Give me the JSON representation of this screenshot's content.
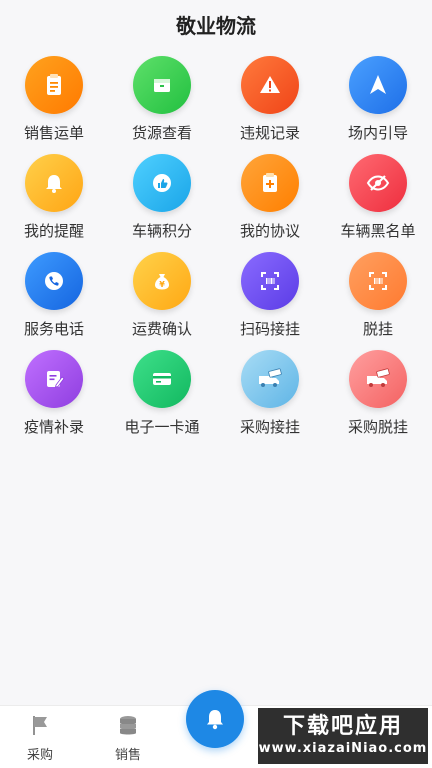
{
  "header": {
    "title": "敬业物流"
  },
  "menu": [
    {
      "label": "销售运单",
      "icon": "clipboard-icon",
      "color": "#ff8a00"
    },
    {
      "label": "货源查看",
      "icon": "box-icon",
      "color": "#3fcf4f"
    },
    {
      "label": "违规记录",
      "icon": "warning-icon",
      "color": "#ff5a22"
    },
    {
      "label": "场内引导",
      "icon": "navigation-arrow-icon",
      "color": "#2f86f6"
    },
    {
      "label": "我的提醒",
      "icon": "bell-icon",
      "color": "#ffb21e"
    },
    {
      "label": "车辆积分",
      "icon": "thumbs-up-icon",
      "color": "#22b7f0"
    },
    {
      "label": "我的协议",
      "icon": "document-plus-icon",
      "color": "#ff8c14"
    },
    {
      "label": "车辆黑名单",
      "icon": "eye-slash-icon",
      "color": "#f5414f"
    },
    {
      "label": "服务电话",
      "icon": "phone-icon",
      "color": "#1e7cf2"
    },
    {
      "label": "运费确认",
      "icon": "money-bag-icon",
      "color": "#ffb41e"
    },
    {
      "label": "扫码接挂",
      "icon": "scan-icon",
      "color": "#6b4cf0"
    },
    {
      "label": "脱挂",
      "icon": "scan-icon",
      "color": "#ff8a3c"
    },
    {
      "label": "疫情补录",
      "icon": "edit-note-icon",
      "color": "#a14ae6"
    },
    {
      "label": "电子一卡通",
      "icon": "card-icon",
      "color": "#1cc46e"
    },
    {
      "label": "采购接挂",
      "icon": "truck-icon",
      "color": "#7fc8f0"
    },
    {
      "label": "采购脱挂",
      "icon": "truck-icon",
      "color": "#ff7a7a"
    }
  ],
  "tabbar": {
    "purchase": "采购",
    "sales": "销售"
  },
  "watermark": {
    "line1": "下载吧应用",
    "line2": "www.xiazaiNiao.com"
  }
}
